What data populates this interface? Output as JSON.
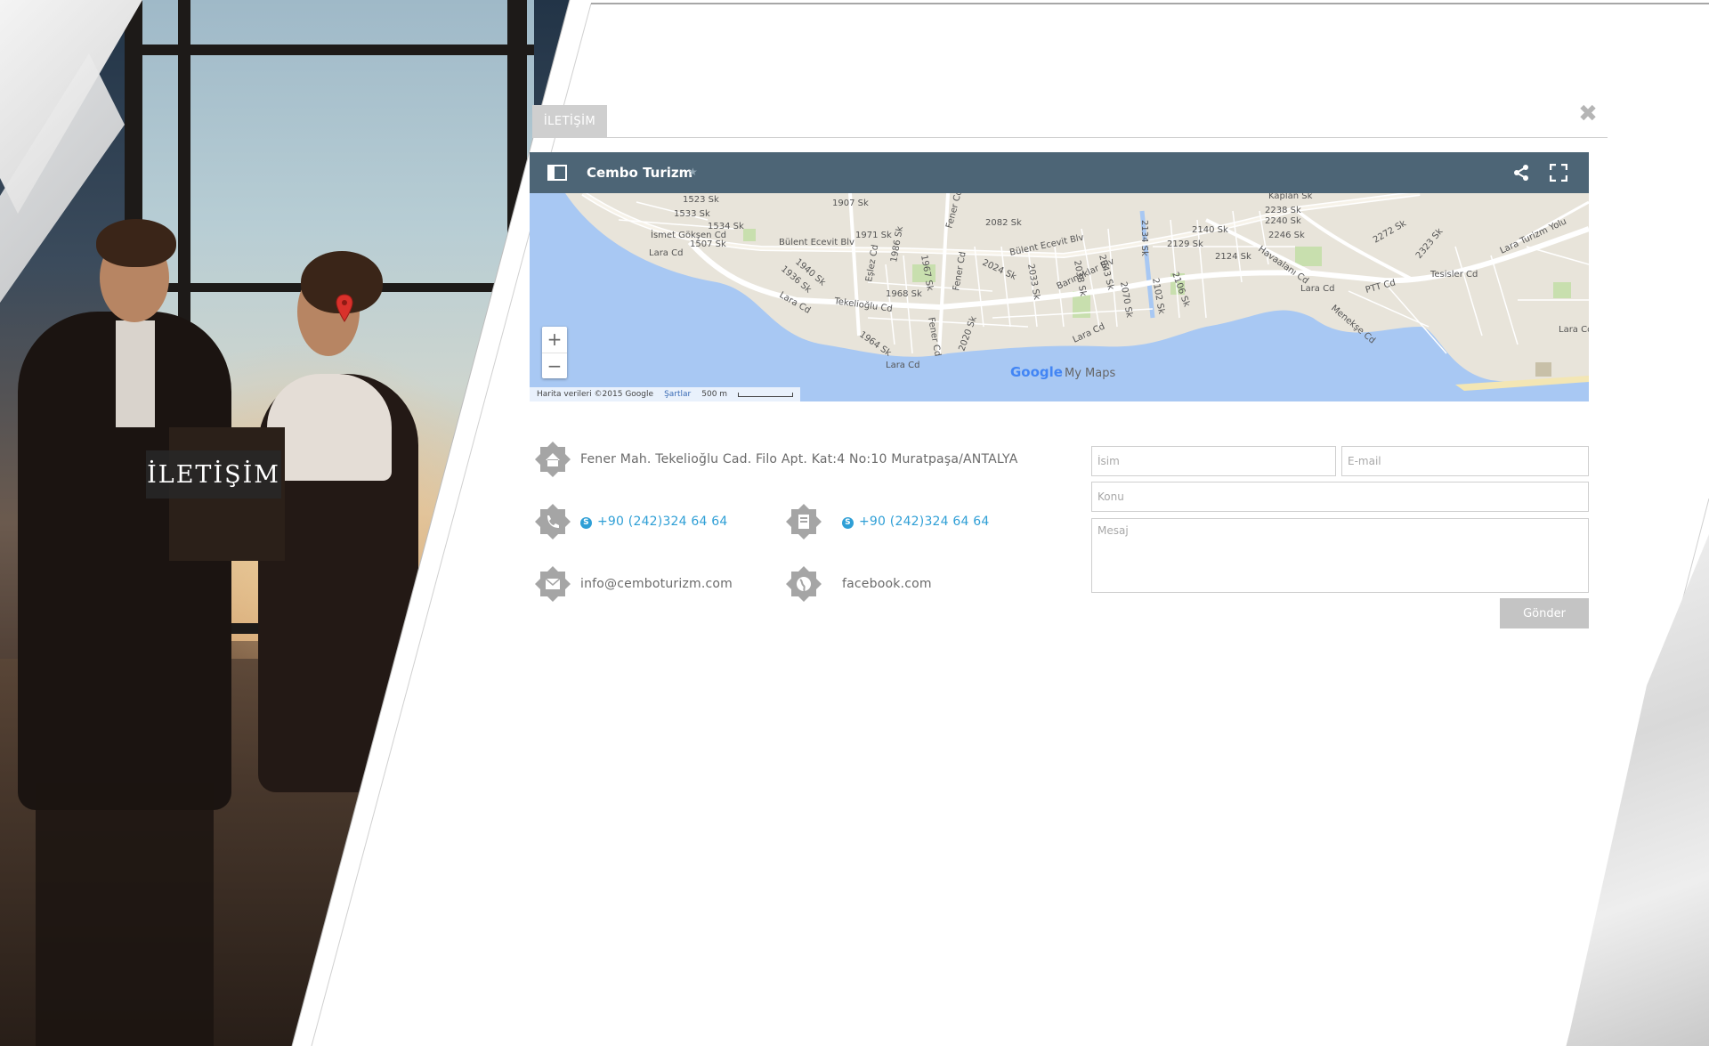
{
  "hero": {
    "label": "İLETİŞİM"
  },
  "modal": {
    "tab_label": "İLETİŞİM",
    "close_icon": "close-icon"
  },
  "map": {
    "title": "Cembo Turizm",
    "brand_google": "Google",
    "brand_mymaps": "My Maps",
    "attribution": "Harita verileri ©2015 Google",
    "terms": "Şartlar",
    "scale": "500 m",
    "zoom_in": "+",
    "zoom_out": "−",
    "streets": [
      "1523 Sk",
      "1533 Sk",
      "1534 Sk",
      "İsmet Gökşen Cd",
      "1507 Sk",
      "Lara Cd",
      "1907 Sk",
      "1971 Sk",
      "Bülent Ecevit Blv",
      "1940 Sk",
      "1936 Sk",
      "Fener Cd",
      "2082 Sk",
      "Bülent Ecevit Blv",
      "2043 Sk",
      "2134 Sk",
      "2140 Sk",
      "2129 Sk",
      "2238 Sk",
      "2240 Sk",
      "2246 Sk",
      "Kaplan Sk",
      "2124 Sk",
      "Havaalanı Cd",
      "2272 Sk",
      "2323 Sk",
      "Lara Turizm Yolu",
      "Tesisler Cd",
      "PTT Cd",
      "Lara Cd",
      "Menekşe Cd",
      "Lara Cd",
      "Barınaklar Blv",
      "2024 Sk",
      "2033 Sk",
      "2038 Sk",
      "2070 Sk",
      "2102 Sk",
      "2106 Sk",
      "Lara Cd",
      "2020 Sk",
      "Fener Cd",
      "1964 Sk",
      "Lara Cd",
      "Tekelioğlu Cd",
      "1968 Sk",
      "1986 Sk",
      "1967 Sk",
      "Fener Cd",
      "Lara Cd",
      "Eşlez Cd"
    ]
  },
  "contact": {
    "address": "Fener Mah. Tekelioğlu Cad. Filo Apt. Kat:4 No:10 Muratpaşa/ANTALYA",
    "phone": "+90 (242)324 64 64",
    "fax": "+90 (242)324 64 64",
    "email": "info@cemboturizm.com",
    "web": "facebook.com"
  },
  "form": {
    "name_placeholder": "İsim",
    "email_placeholder": "E-mail",
    "subject_placeholder": "Konu",
    "message_placeholder": "Mesaj",
    "send_label": "Gönder"
  },
  "colors": {
    "map_bar": "#4d6576",
    "link_blue": "#2f9fd6",
    "badge_gray": "#a5a5a5",
    "button_gray": "#c4c4c4"
  }
}
